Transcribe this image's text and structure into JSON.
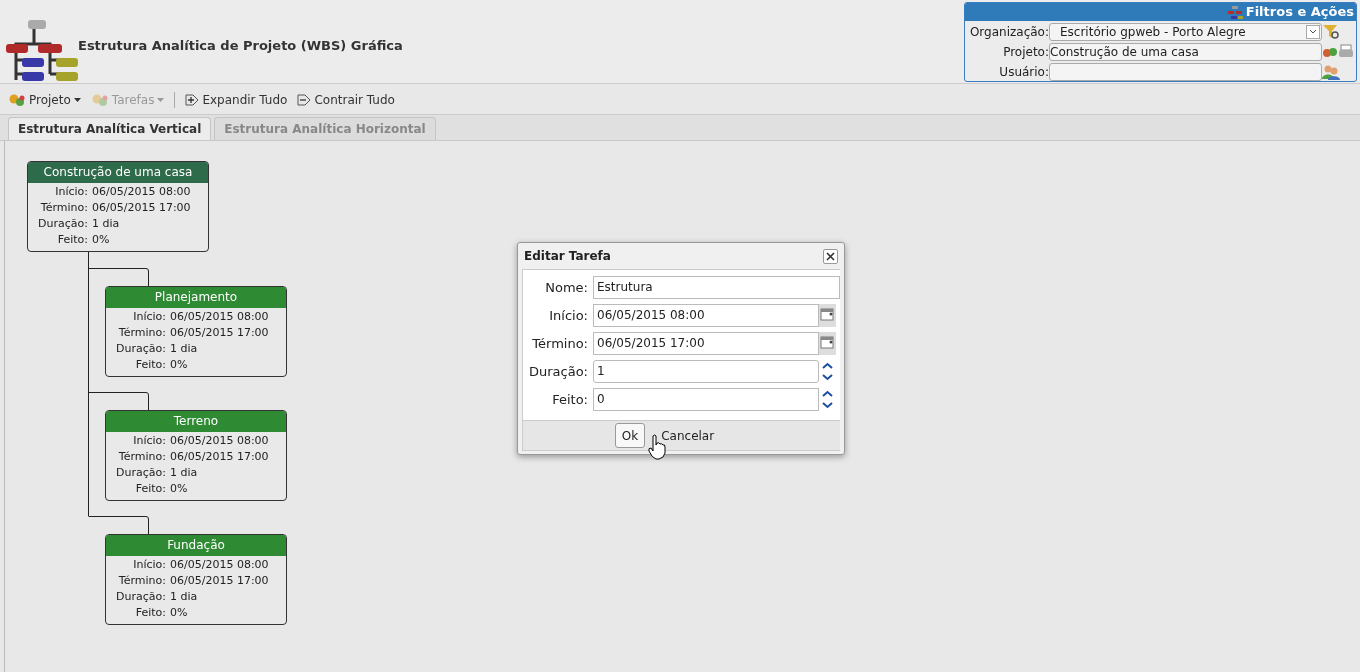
{
  "header": {
    "title": "Estrutura Analítica de Projeto (WBS) Gráfica"
  },
  "filters": {
    "title": "Filtros e Ações",
    "fields": [
      {
        "kind": "select",
        "label": "Organização:",
        "value": "Escritório gpweb - Porto Alegre"
      },
      {
        "kind": "text",
        "label": "Projeto:",
        "value": "Construção de uma casa"
      },
      {
        "kind": "text",
        "label": "Usuário:"
      }
    ]
  },
  "toolbar": [
    {
      "kind": "menu",
      "label": "Projeto",
      "disabled": false
    },
    {
      "kind": "menu",
      "label": "Tarefas",
      "disabled": true
    },
    {
      "kind": "expand",
      "label": "Expandir Tudo",
      "disabled": false
    },
    {
      "kind": "collapse",
      "label": "Contrair Tudo",
      "disabled": false
    }
  ],
  "tabs": [
    {
      "label": "Estrutura Analítica Vertical",
      "selected": true
    },
    {
      "label": "Estrutura Analítica Horizontal",
      "selected": false
    }
  ],
  "wbs": {
    "name": "Construção de uma casa",
    "color": "#2e6b4a",
    "fields": [
      [
        "Início:",
        "06/05/2015 08:00"
      ],
      [
        "Término:",
        "06/05/2015 17:00"
      ],
      [
        "Duração:",
        "1 dia"
      ],
      [
        "Feito:",
        "0%"
      ]
    ],
    "children": [
      {
        "name": "Planejamento",
        "color": "#2f8a34",
        "fields": [
          [
            "Início:",
            "06/05/2015 08:00"
          ],
          [
            "Término:",
            "06/05/2015 17:00"
          ],
          [
            "Duração:",
            "1 dia"
          ],
          [
            "Feito:",
            "0%"
          ]
        ]
      },
      {
        "name": "Terreno",
        "color": "#2f8a34",
        "fields": [
          [
            "Início:",
            "06/05/2015 08:00"
          ],
          [
            "Término:",
            "06/05/2015 17:00"
          ],
          [
            "Duração:",
            "1 dia"
          ],
          [
            "Feito:",
            "0%"
          ]
        ]
      },
      {
        "name": "Fundação",
        "color": "#2f8a34",
        "fields": [
          [
            "Início:",
            "06/05/2015 08:00"
          ],
          [
            "Término:",
            "06/05/2015 17:00"
          ],
          [
            "Duração:",
            "1 dia"
          ],
          [
            "Feito:",
            "0%"
          ]
        ]
      }
    ]
  },
  "dialog": {
    "title": "Editar Tarefa",
    "fields": [
      {
        "kind": "text",
        "label": "Nome:",
        "value": "Estrutura"
      },
      {
        "kind": "date",
        "label": "Início:",
        "value": "06/05/2015 08:00"
      },
      {
        "kind": "date",
        "label": "Término:",
        "value": "06/05/2015 17:00"
      },
      {
        "kind": "spin",
        "label": "Duração:",
        "value": "1"
      },
      {
        "kind": "spin",
        "label": "Feito:",
        "value": "0"
      }
    ],
    "buttons": [
      "Ok",
      "Cancelar"
    ]
  }
}
